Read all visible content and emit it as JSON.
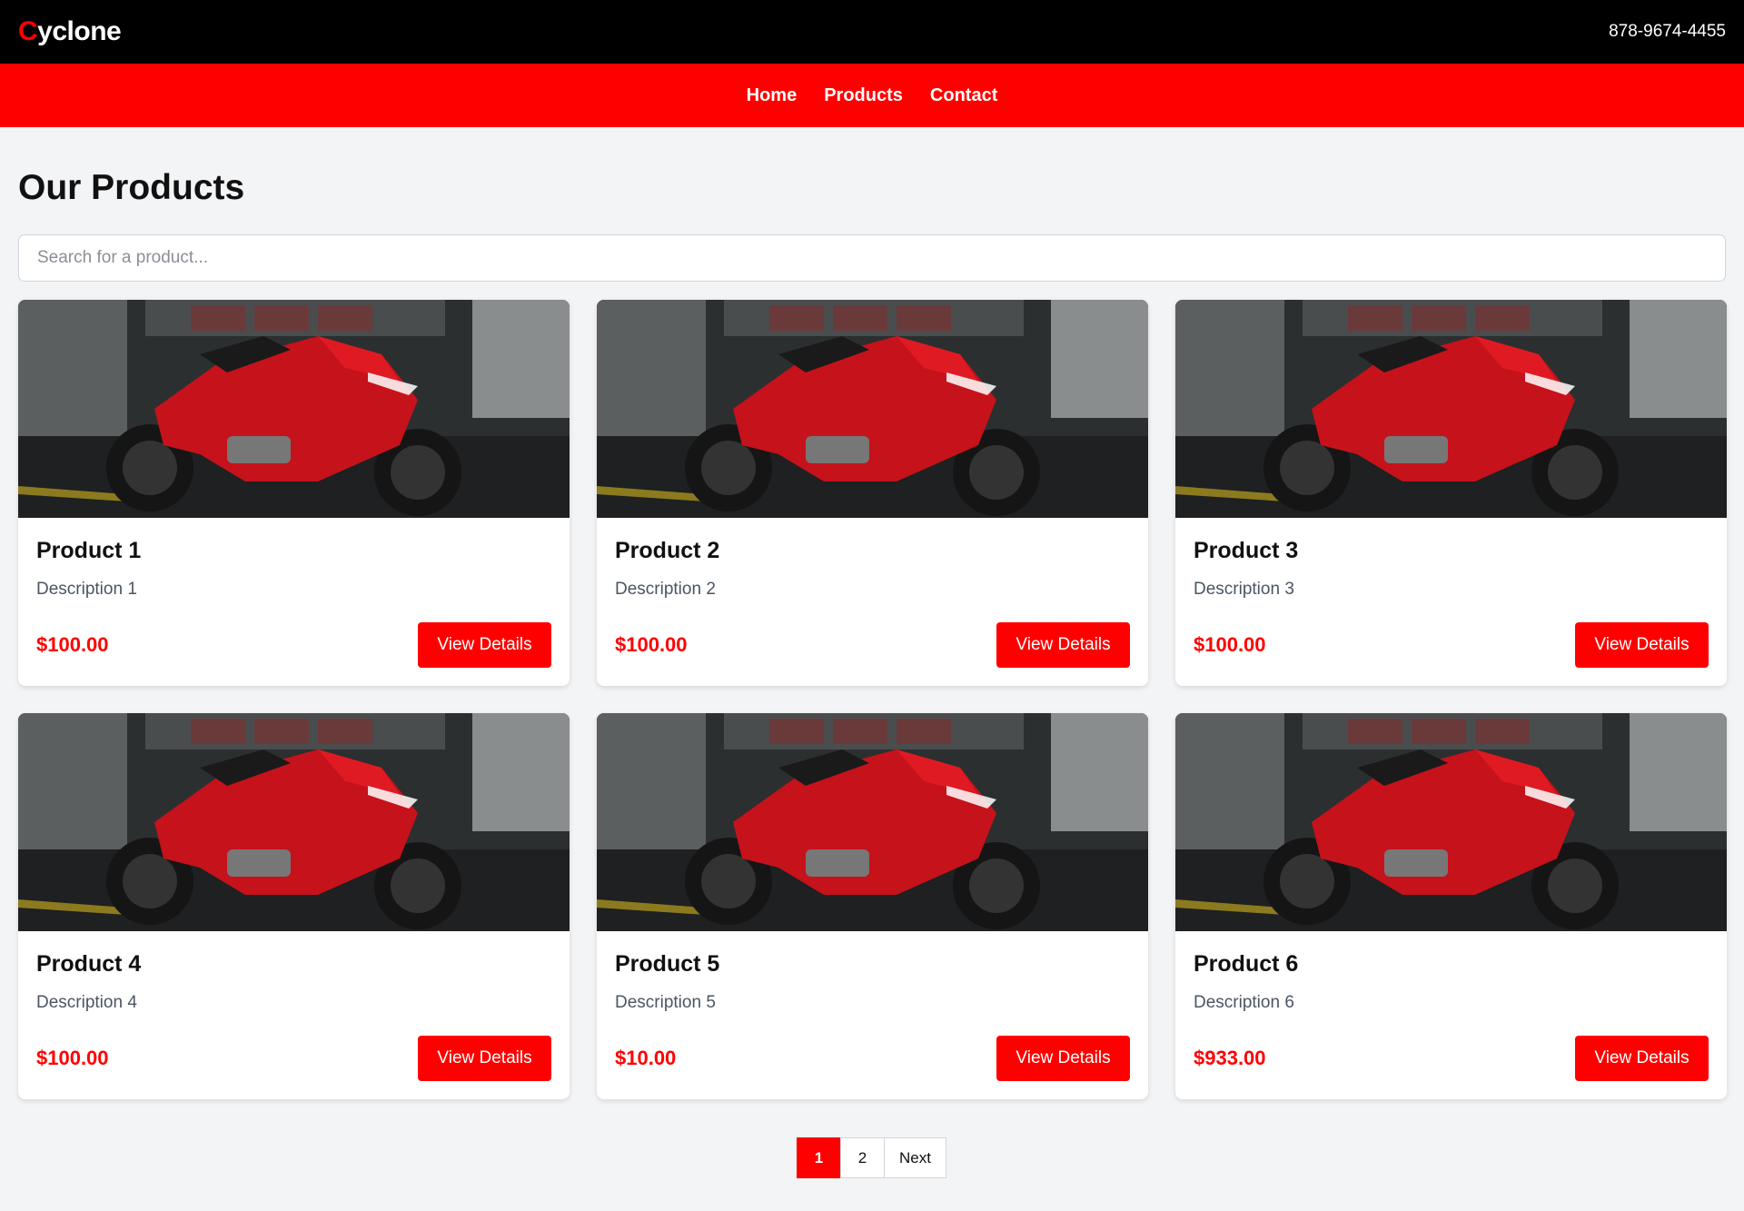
{
  "brand": {
    "first_letter": "C",
    "rest": "yclone"
  },
  "header": {
    "phone": "878-9674-4455"
  },
  "nav": [
    {
      "label": "Home"
    },
    {
      "label": "Products"
    },
    {
      "label": "Contact"
    }
  ],
  "page": {
    "title": "Our Products"
  },
  "search": {
    "placeholder": "Search for a product..."
  },
  "products": [
    {
      "title": "Product 1",
      "description": "Description 1",
      "price": "$100.00",
      "button": "View Details"
    },
    {
      "title": "Product 2",
      "description": "Description 2",
      "price": "$100.00",
      "button": "View Details"
    },
    {
      "title": "Product 3",
      "description": "Description 3",
      "price": "$100.00",
      "button": "View Details"
    },
    {
      "title": "Product 4",
      "description": "Description 4",
      "price": "$100.00",
      "button": "View Details"
    },
    {
      "title": "Product 5",
      "description": "Description 5",
      "price": "$10.00",
      "button": "View Details"
    },
    {
      "title": "Product 6",
      "description": "Description 6",
      "price": "$933.00",
      "button": "View Details"
    }
  ],
  "pagination": {
    "pages": [
      "1",
      "2"
    ],
    "active": "1",
    "next": "Next"
  },
  "colors": {
    "accent": "#ff0000",
    "topbar": "#000000",
    "background": "#f3f4f6"
  },
  "icons": {
    "product_image": "red-motorcycle-image"
  }
}
